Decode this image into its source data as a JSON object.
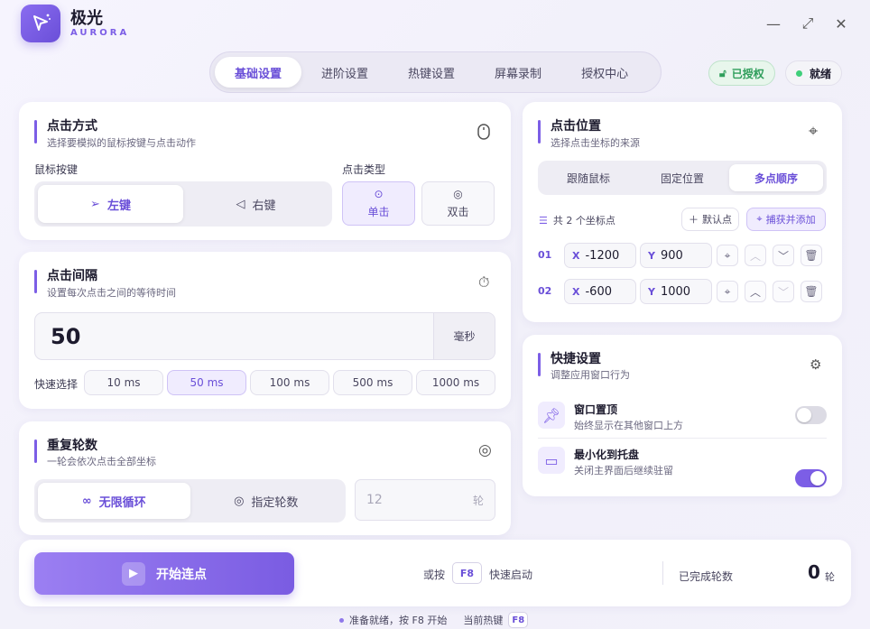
{
  "app": {
    "title": "极光",
    "subtitle": "AURORA"
  },
  "window": {
    "minimize": "—",
    "maximize": "⤢",
    "close": "✕"
  },
  "tabs": [
    {
      "label": "基础设置",
      "active": true
    },
    {
      "label": "进阶设置",
      "active": false
    },
    {
      "label": "热键设置",
      "active": false
    },
    {
      "label": "屏幕录制",
      "active": false
    },
    {
      "label": "授权中心",
      "active": false
    }
  ],
  "status": {
    "license": "已授权",
    "ready": "就绪"
  },
  "click_mode": {
    "title": "点击方式",
    "subtitle": "选择要模拟的鼠标按键与点击动作",
    "button_label": "鼠标按键",
    "left": "左键",
    "right": "右键",
    "type_label": "点击类型",
    "single": "单击",
    "double": "双击"
  },
  "interval": {
    "title": "点击间隔",
    "subtitle": "设置每次点击之间的等待时间",
    "value": "50",
    "unit": "毫秒",
    "quick_label": "快速选择",
    "presets": [
      "10 ms",
      "50 ms",
      "100 ms",
      "500 ms",
      "1000 ms"
    ],
    "selected": "50 ms"
  },
  "repeat": {
    "title": "重复轮数",
    "subtitle": "一轮会依次点击全部坐标",
    "infinite": "无限循环",
    "fixed": "指定轮数",
    "count_placeholder": "12",
    "count_unit": "轮"
  },
  "position": {
    "title": "点击位置",
    "subtitle": "选择点击坐标的来源",
    "modes": [
      "跟随鼠标",
      "固定位置",
      "多点顺序"
    ],
    "active_mode": "多点顺序",
    "count_text": "共 2 个坐标点",
    "default_btn": "默认点",
    "capture_btn": "捕获并添加",
    "points": [
      {
        "index": "01",
        "x_label": "X",
        "x": "-1200",
        "y_label": "Y",
        "y": "900"
      },
      {
        "index": "02",
        "x_label": "X",
        "x": "-600",
        "y_label": "Y",
        "y": "1000"
      }
    ]
  },
  "shortcuts": {
    "title": "快捷设置",
    "subtitle": "调整应用窗口行为",
    "items": [
      {
        "title": "窗口置顶",
        "desc": "始终显示在其他窗口上方",
        "on": false
      },
      {
        "title": "最小化到托盘",
        "desc": "关闭主界面后继续驻留",
        "on": true
      }
    ]
  },
  "footer": {
    "start": "开始连点",
    "or_press": "或按",
    "hotkey": "F8",
    "quick_start": "快速启动",
    "completed_label": "已完成轮数",
    "completed_value": "0",
    "completed_unit": "轮"
  },
  "statusbar": {
    "ready_text": "准备就绪，按 F8 开始",
    "hotkey_label": "当前热键",
    "hotkey": "F8"
  },
  "colors": {
    "accent": "#7c5ee6",
    "success": "#2f9e5b"
  }
}
